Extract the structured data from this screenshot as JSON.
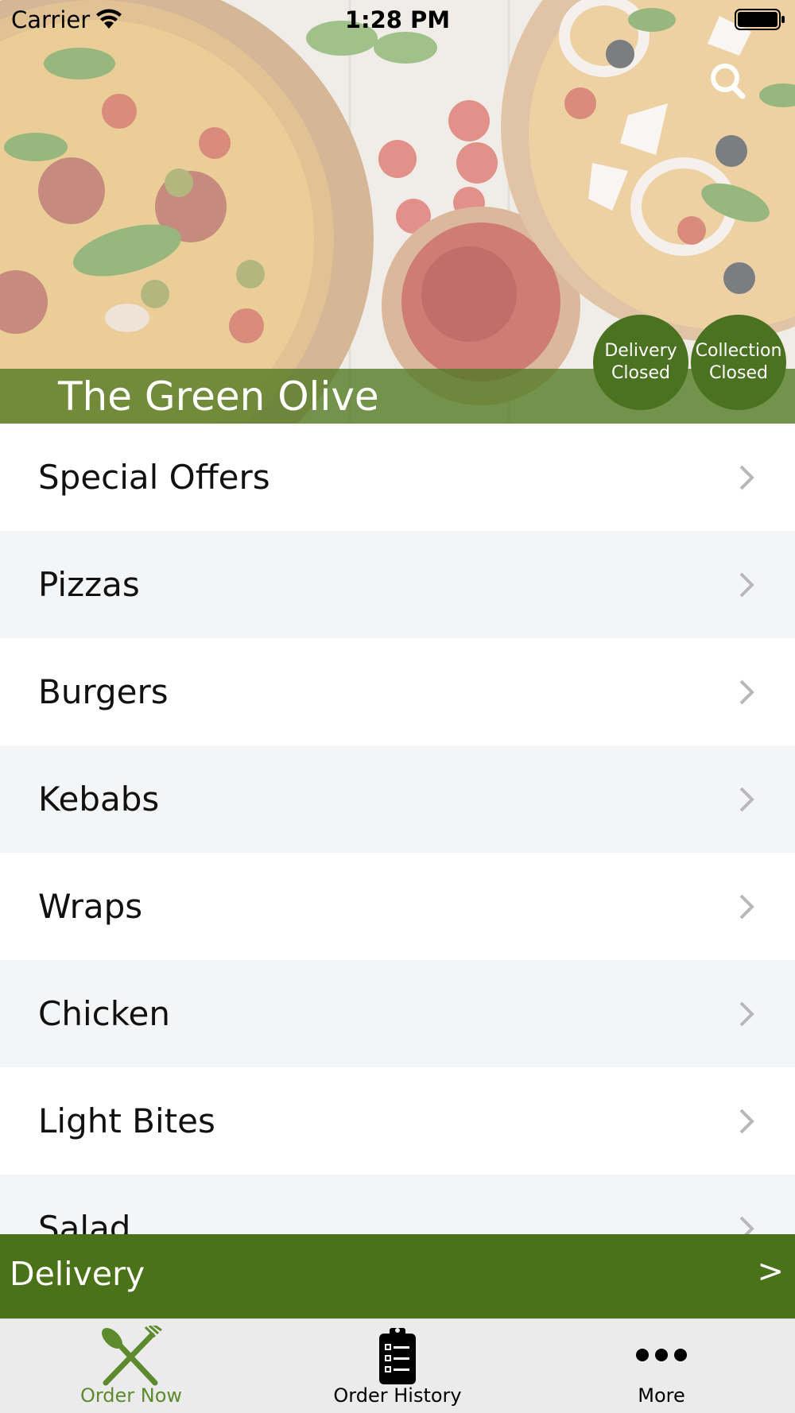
{
  "status_bar": {
    "carrier": "Carrier",
    "time": "1:28 PM"
  },
  "hero": {
    "restaurant_name": "The Green Olive",
    "delivery_status": {
      "line1": "Delivery",
      "line2": "Closed"
    },
    "collection_status": {
      "line1": "Collection",
      "line2": "Closed"
    }
  },
  "menu": {
    "categories": [
      {
        "label": "Special Offers"
      },
      {
        "label": "Pizzas"
      },
      {
        "label": "Burgers"
      },
      {
        "label": "Kebabs"
      },
      {
        "label": "Wraps"
      },
      {
        "label": "Chicken"
      },
      {
        "label": "Light Bites"
      },
      {
        "label": "Salad"
      }
    ]
  },
  "delivery_bar": {
    "label": "Delivery",
    "arrow": ">"
  },
  "tab_bar": {
    "tabs": [
      {
        "label": "Order Now",
        "icon": "fork-knife-icon",
        "selected": true
      },
      {
        "label": "Order History",
        "icon": "clipboard-list-icon",
        "selected": false
      },
      {
        "label": "More",
        "icon": "more-dots-icon",
        "selected": false
      }
    ]
  },
  "colors": {
    "brand_green": "#4a7219",
    "tab_selected": "#5c8a2c",
    "row_alt": "#f4f5f7"
  }
}
